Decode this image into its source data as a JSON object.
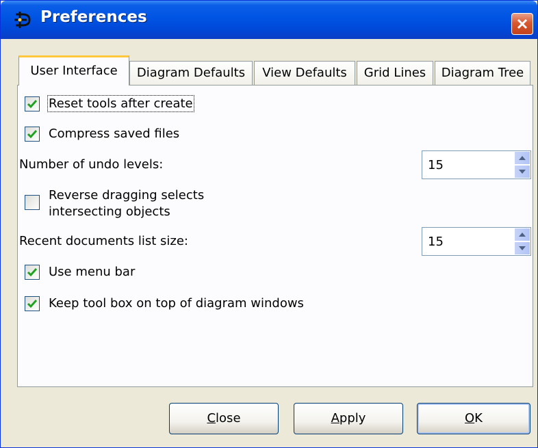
{
  "window": {
    "title": "Preferences"
  },
  "tabs": [
    {
      "label": "User Interface",
      "active": true
    },
    {
      "label": "Diagram Defaults",
      "active": false
    },
    {
      "label": "View Defaults",
      "active": false
    },
    {
      "label": "Grid Lines",
      "active": false
    },
    {
      "label": "Diagram Tree",
      "active": false
    }
  ],
  "options": {
    "reset_tools": {
      "label": "Reset tools after create",
      "checked": true
    },
    "compress": {
      "label": "Compress saved files",
      "checked": true
    },
    "undo_levels": {
      "label": "Number of undo levels:",
      "value": "15"
    },
    "reverse_drag": {
      "label_line1": "Reverse dragging selects",
      "label_line2": "intersecting objects",
      "checked": false
    },
    "recent_docs": {
      "label": "Recent documents list size:",
      "value": "15"
    },
    "menu_bar": {
      "label": "Use menu bar",
      "checked": true
    },
    "toolbox_top": {
      "label": "Keep tool box on top of diagram windows",
      "checked": true
    }
  },
  "buttons": {
    "close": {
      "mnemonic": "C",
      "rest": "lose"
    },
    "apply": {
      "mnemonic": "A",
      "rest": "pply"
    },
    "ok": {
      "mnemonic": "O",
      "rest": "K"
    }
  },
  "colors": {
    "titlebar": "#0054e3",
    "dialog": "#ece9d8",
    "check": "#21a121",
    "tab_highlight": "#ffc83c"
  }
}
